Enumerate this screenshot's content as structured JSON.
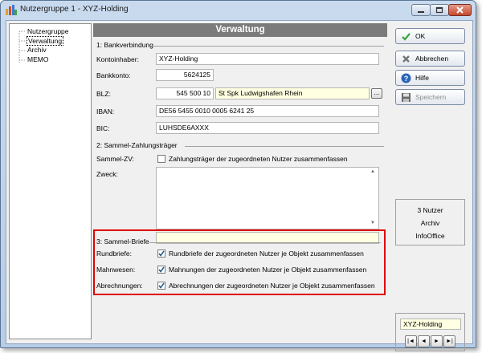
{
  "window": {
    "title": "Nutzergruppe 1 - XYZ-Holding"
  },
  "tree": {
    "items": [
      {
        "label": "Nutzergruppe"
      },
      {
        "label": "Verwaltung"
      },
      {
        "label": "Archiv"
      },
      {
        "label": "MEMO"
      }
    ],
    "selected": "Verwaltung"
  },
  "panel": {
    "title": "Verwaltung"
  },
  "bank": {
    "group_title": "1: Bankverbindung",
    "kontoinhaber_label": "Kontoinhaber:",
    "kontoinhaber_value": "XYZ-Holding",
    "bankkonto_label": "Bankkonto:",
    "bankkonto_value": "5624125",
    "blz_label": "BLZ:",
    "blz_value": "545 500 10",
    "bank_name": "St Spk Ludwigshafen Rhein",
    "lookup_button": "...",
    "iban_label": "IBAN:",
    "iban_value": "DE56 5455 0010 0005 6241 25",
    "bic_label": "BIC:",
    "bic_value": "LUHSDE6AXXX"
  },
  "sammel_zv": {
    "group_title": "2: Sammel-Zahlungsträger",
    "label": "Sammel-ZV:",
    "checkbox_label": "Zahlungsträger der zugeordneten Nutzer zusammenfassen",
    "checked": false,
    "zweck_label": "Zweck:",
    "zweck_value": ""
  },
  "sammel_briefe": {
    "group_title": "3: Sammel-Briefe",
    "rows": [
      {
        "label": "Rundbriefe:",
        "checkbox_label": "Rundbriefe der zugeordneten Nutzer je Objekt zusammenfassen",
        "checked": true
      },
      {
        "label": "Mahnwesen:",
        "checkbox_label": "Mahnungen der zugeordneten Nutzer je Objekt zusammenfassen",
        "checked": true
      },
      {
        "label": "Abrechnungen:",
        "checkbox_label": "Abrechnungen der zugeordneten Nutzer je Objekt zusammenfassen",
        "checked": true
      }
    ]
  },
  "buttons": {
    "ok": "OK",
    "abbrechen": "Abbrechen",
    "hilfe": "Hilfe",
    "speichern": "Speichern"
  },
  "info": {
    "lines": [
      "3 Nutzer",
      "Archiv",
      "InfoOffice"
    ]
  },
  "nav": {
    "current": "XYZ-Holding",
    "first": "|◄",
    "prev": "◄",
    "next": "►",
    "last": "►|"
  },
  "colors": {
    "header": "#7b7b7b",
    "highlight_border": "#e00000",
    "yellow_field": "#ffffe1"
  }
}
